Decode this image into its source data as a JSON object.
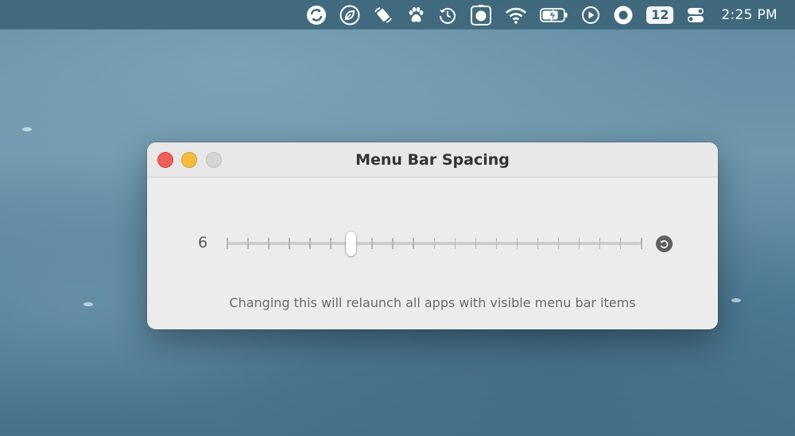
{
  "menubar": {
    "items": [
      {
        "name": "sync-icon"
      },
      {
        "name": "leaf-icon"
      },
      {
        "name": "rotate-device-icon"
      },
      {
        "name": "paw-icon"
      },
      {
        "name": "time-machine-icon"
      },
      {
        "name": "camera-icon"
      },
      {
        "name": "wifi-icon"
      },
      {
        "name": "battery-charging-icon"
      },
      {
        "name": "play-icon"
      },
      {
        "name": "record-icon"
      }
    ],
    "badge": "12",
    "clock": "2:25 PM"
  },
  "window": {
    "title": "Menu Bar Spacing",
    "slider": {
      "value_label": "6",
      "value": 6,
      "min": 0,
      "max": 20,
      "tick_count": 21
    },
    "notice": "Changing this will relaunch all apps with visible menu bar items"
  },
  "colors": {
    "close": "#ee5f58",
    "minimize": "#f5bd3f",
    "zoom_disabled": "#d4d4d4",
    "menubar": "#3e667a",
    "window_bg": "#ececec"
  }
}
